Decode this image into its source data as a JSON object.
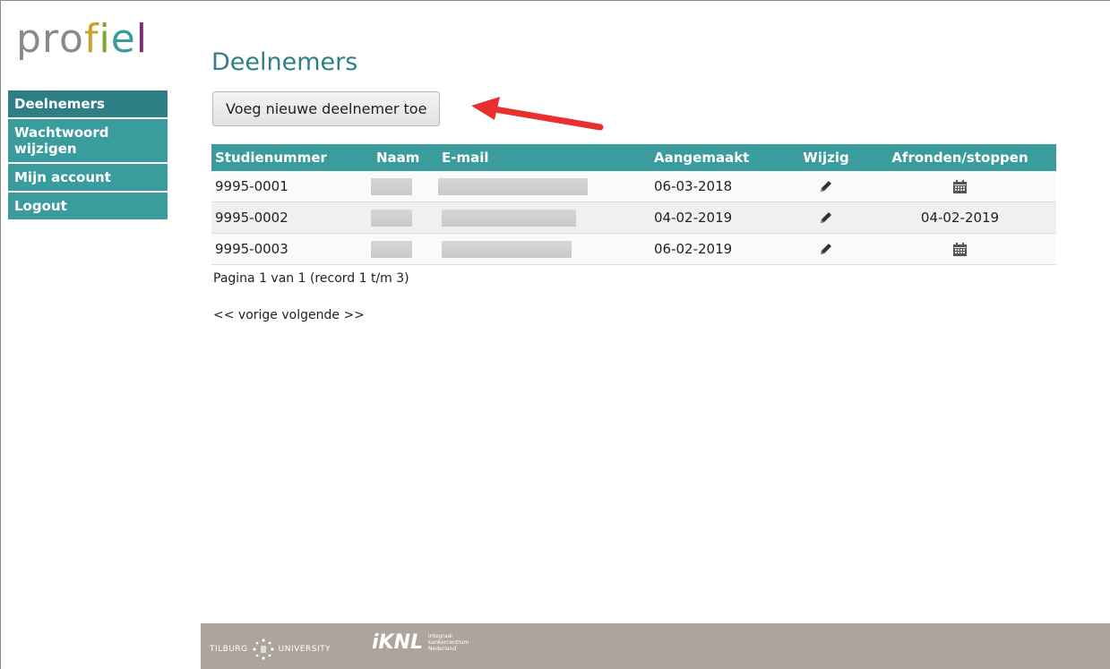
{
  "logo": {
    "letters": [
      "p",
      "r",
      "o",
      "f",
      "i",
      "e",
      "l"
    ],
    "colors": [
      "#8a8a8a",
      "#8a8a8a",
      "#8a8a8a",
      "#c9a227",
      "#7da92b",
      "#3a9c9c",
      "#7b2d6e"
    ]
  },
  "sidebar": {
    "items": [
      {
        "label": "Deelnemers"
      },
      {
        "label": "Wachtwoord wijzigen"
      },
      {
        "label": "Mijn account"
      },
      {
        "label": "Logout"
      }
    ]
  },
  "page": {
    "title": "Deelnemers",
    "add_button": "Voeg nieuwe deelnemer toe"
  },
  "table": {
    "headers": {
      "studienummer": "Studienummer",
      "naam": "Naam",
      "email": "E-mail",
      "aangemaakt": "Aangemaakt",
      "wijzig": "Wijzig",
      "afronden": "Afronden/stoppen"
    },
    "rows": [
      {
        "studienummer": "9995-0001",
        "aangemaakt": "06-03-2018",
        "afronden": "",
        "afronden_icon": "calendar-icon"
      },
      {
        "studienummer": "9995-0002",
        "aangemaakt": "04-02-2019",
        "afronden": "04-02-2019",
        "afronden_icon": ""
      },
      {
        "studienummer": "9995-0003",
        "aangemaakt": "06-02-2019",
        "afronden": "",
        "afronden_icon": "calendar-icon"
      }
    ]
  },
  "pager": {
    "info": "Pagina 1 van 1 (record 1 t/m 3)",
    "prev": "<< vorige",
    "next": "volgende >>"
  },
  "footer": {
    "tilburg_left": "Tilburg",
    "tilburg_right": "University",
    "knl_mark": "iKNL",
    "knl_line1": "integraal",
    "knl_line2": "kankercentrum",
    "knl_line3": "Nederland"
  },
  "colors": {
    "accent": "#3a9c9c",
    "accent_dark": "#2d7f85",
    "title": "#2f7f86",
    "footer": "#ada49b",
    "arrow": "#e8302e"
  }
}
